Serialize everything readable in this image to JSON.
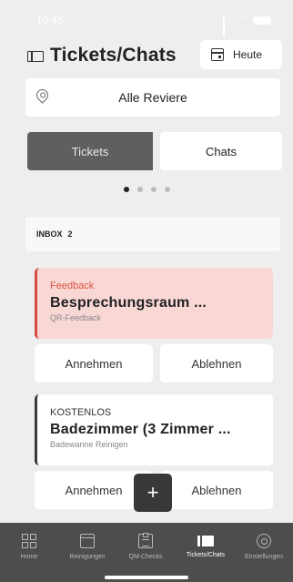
{
  "status_bar": {
    "time": "10:45"
  },
  "header": {
    "title": "Tickets/Chats",
    "today_label": "Heute"
  },
  "area_select": {
    "value": "Alle Reviere"
  },
  "segments": {
    "tickets": "Tickets",
    "chats": "Chats"
  },
  "pager": {
    "count": 4,
    "active": 1
  },
  "inbox": {
    "label": "INBOX",
    "count": "2"
  },
  "tickets": [
    {
      "category": "Feedback",
      "title": "Besprechungsraum ...",
      "subtitle": "QR-Feedback",
      "accept_label": "Annehmen",
      "reject_label": "Ablehnen",
      "accent_color": "#d94a42"
    },
    {
      "category": "KOSTENLOS",
      "title": "Badezimmer (3 Zimmer ...",
      "subtitle": "Badewanne Reinigen",
      "accept_label": "Annehmen",
      "reject_label": "Ablehnen",
      "accent_color": "#3a3a3a"
    }
  ],
  "fab": {
    "label": "+"
  },
  "tabbar": {
    "items": [
      {
        "label": "Home",
        "icon": "grid-icon"
      },
      {
        "label": "Reinigungen",
        "icon": "calendar-icon"
      },
      {
        "label": "QM-Checks",
        "icon": "clipboard-icon"
      },
      {
        "label": "Tickets/Chats",
        "icon": "ticket-icon",
        "active": true
      },
      {
        "label": "Einstellungen",
        "icon": "gear-icon"
      }
    ]
  }
}
